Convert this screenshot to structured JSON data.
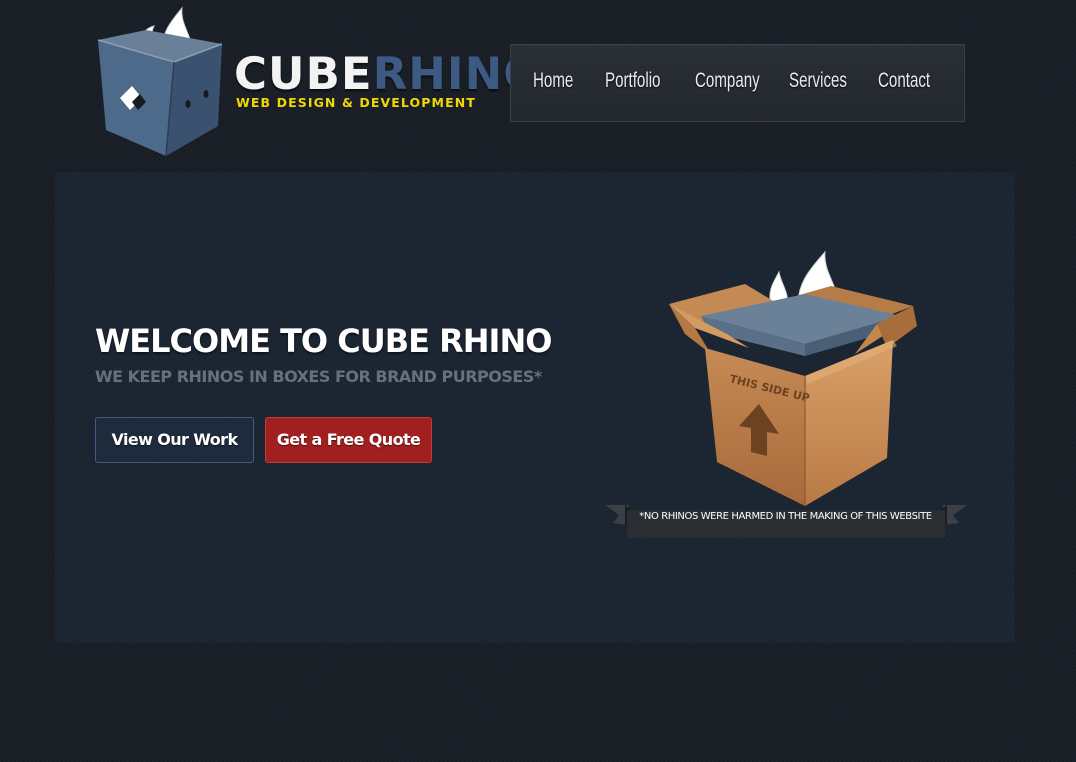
{
  "brand": {
    "name_part1": "CUBE",
    "name_part2": "RHINO",
    "tagline": "WEB DESIGN & DEVELOPMENT",
    "colors": {
      "name_part1": "#f3f3f3",
      "name_part2": "#3c5a84",
      "tagline": "#f0d800"
    }
  },
  "nav": {
    "items": [
      {
        "label": "Home"
      },
      {
        "label": "Portfolio"
      },
      {
        "label": "Company"
      },
      {
        "label": "Services"
      },
      {
        "label": "Contact"
      }
    ]
  },
  "hero": {
    "title": "WELCOME TO CUBE RHINO",
    "subtitle": "WE KEEP RHINOS IN BOXES FOR BRAND PURPOSES*",
    "buttons": {
      "work": "View Our Work",
      "quote": "Get a Free Quote"
    },
    "box_label": "THIS SIDE UP",
    "disclaimer": "*NO RHINOS WERE HARMED IN THE MAKING OF THIS WEBSITE",
    "colors": {
      "background": "#1b2532",
      "quote_button": "#a11f1f",
      "work_button": "#1d2b3c"
    }
  }
}
